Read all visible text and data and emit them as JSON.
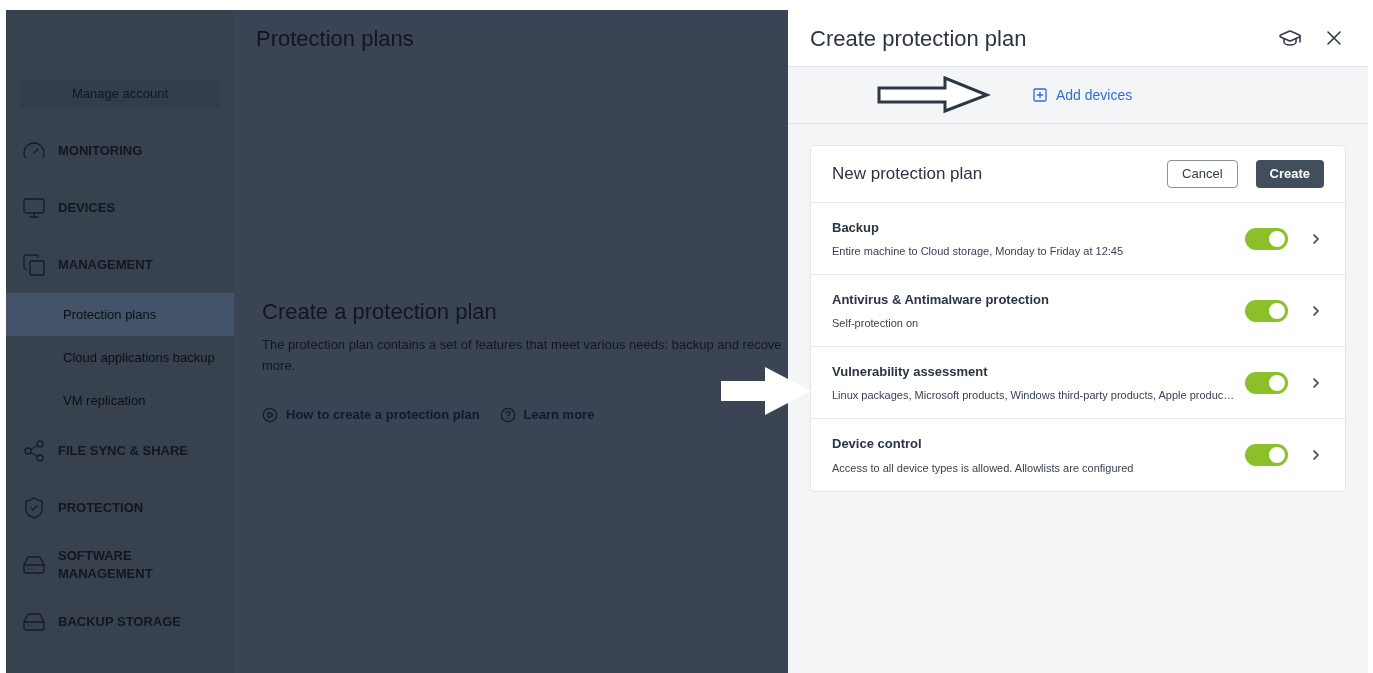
{
  "background_page": {
    "title": "Protection plans",
    "manage_account": "Manage account",
    "sidebar": {
      "items": [
        {
          "kind": "section",
          "label": "MONITORING",
          "selected": false
        },
        {
          "kind": "section",
          "label": "DEVICES",
          "selected": false
        },
        {
          "kind": "section",
          "label": "MANAGEMENT",
          "selected": false
        },
        {
          "kind": "sub",
          "label": "Protection plans",
          "selected": true
        },
        {
          "kind": "sub",
          "label": "Cloud applications backup",
          "selected": false
        },
        {
          "kind": "sub",
          "label": "VM replication",
          "selected": false
        },
        {
          "kind": "section",
          "label": "FILE SYNC & SHARE",
          "selected": false
        },
        {
          "kind": "section",
          "label": "PROTECTION",
          "selected": false
        },
        {
          "kind": "section",
          "label": "SOFTWARE MANAGEMENT",
          "selected": false
        },
        {
          "kind": "section",
          "label": "BACKUP STORAGE",
          "selected": false
        }
      ]
    },
    "empty_state": {
      "heading": "Create a protection plan",
      "description": "The protection plan contains a set of features that meet various needs: backup and recove",
      "description_more": "more.",
      "links": [
        {
          "kind": "video",
          "label": "How to create a protection plan"
        },
        {
          "kind": "help",
          "label": "Learn more"
        }
      ]
    }
  },
  "panel": {
    "title": "Create protection plan",
    "add_devices": "Add devices",
    "plan": {
      "name": "New protection plan",
      "buttons": [
        {
          "kind": "secondary",
          "label": "Cancel"
        },
        {
          "kind": "primary",
          "label": "Create"
        }
      ],
      "modules": [
        {
          "title": "Backup",
          "summary": "Entire machine to Cloud storage, Monday to Friday at 12:45",
          "on": true
        },
        {
          "title": "Antivirus & Antimalware protection",
          "summary": "Self-protection on",
          "on": true
        },
        {
          "title": "Vulnerability assessment",
          "summary": "Linux packages, Microsoft products, Windows third-party products, Apple produc…",
          "on": true
        },
        {
          "title": "Device control",
          "summary": "Access to all device types is allowed. Allowlists are configured",
          "on": true
        }
      ]
    }
  }
}
